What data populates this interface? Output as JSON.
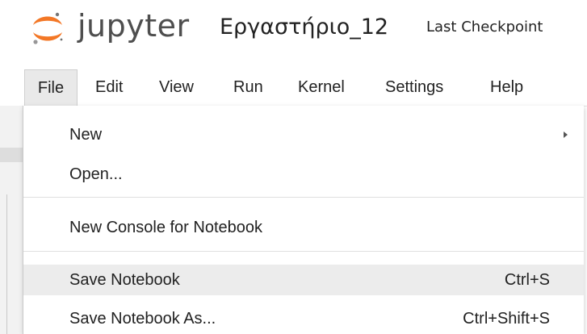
{
  "header": {
    "logo_text": "jupyter",
    "notebook_title": "Εργαστήριο_12",
    "checkpoint_text": "Last Checkpoint"
  },
  "menubar": {
    "items": [
      {
        "label": "File"
      },
      {
        "label": "Edit"
      },
      {
        "label": "View"
      },
      {
        "label": "Run"
      },
      {
        "label": "Kernel"
      },
      {
        "label": "Settings"
      },
      {
        "label": "Help"
      }
    ],
    "active": "File"
  },
  "file_menu": {
    "items": [
      {
        "label": "New",
        "shortcut": "",
        "has_submenu": true
      },
      {
        "label": "Open...",
        "shortcut": ""
      },
      {
        "label": "New Console for Notebook",
        "shortcut": ""
      },
      {
        "label": "Save Notebook",
        "shortcut": "Ctrl+S",
        "highlighted": true
      },
      {
        "label": "Save Notebook As...",
        "shortcut": "Ctrl+Shift+S"
      }
    ]
  },
  "colors": {
    "logo_orange": "#f37726",
    "logo_text": "#4e4e4e",
    "highlight": "#ececec",
    "active_menu": "#e9e9e9"
  },
  "icons": {
    "logo": "jupyter-logo-icon",
    "submenu": "chevron-right-icon"
  }
}
